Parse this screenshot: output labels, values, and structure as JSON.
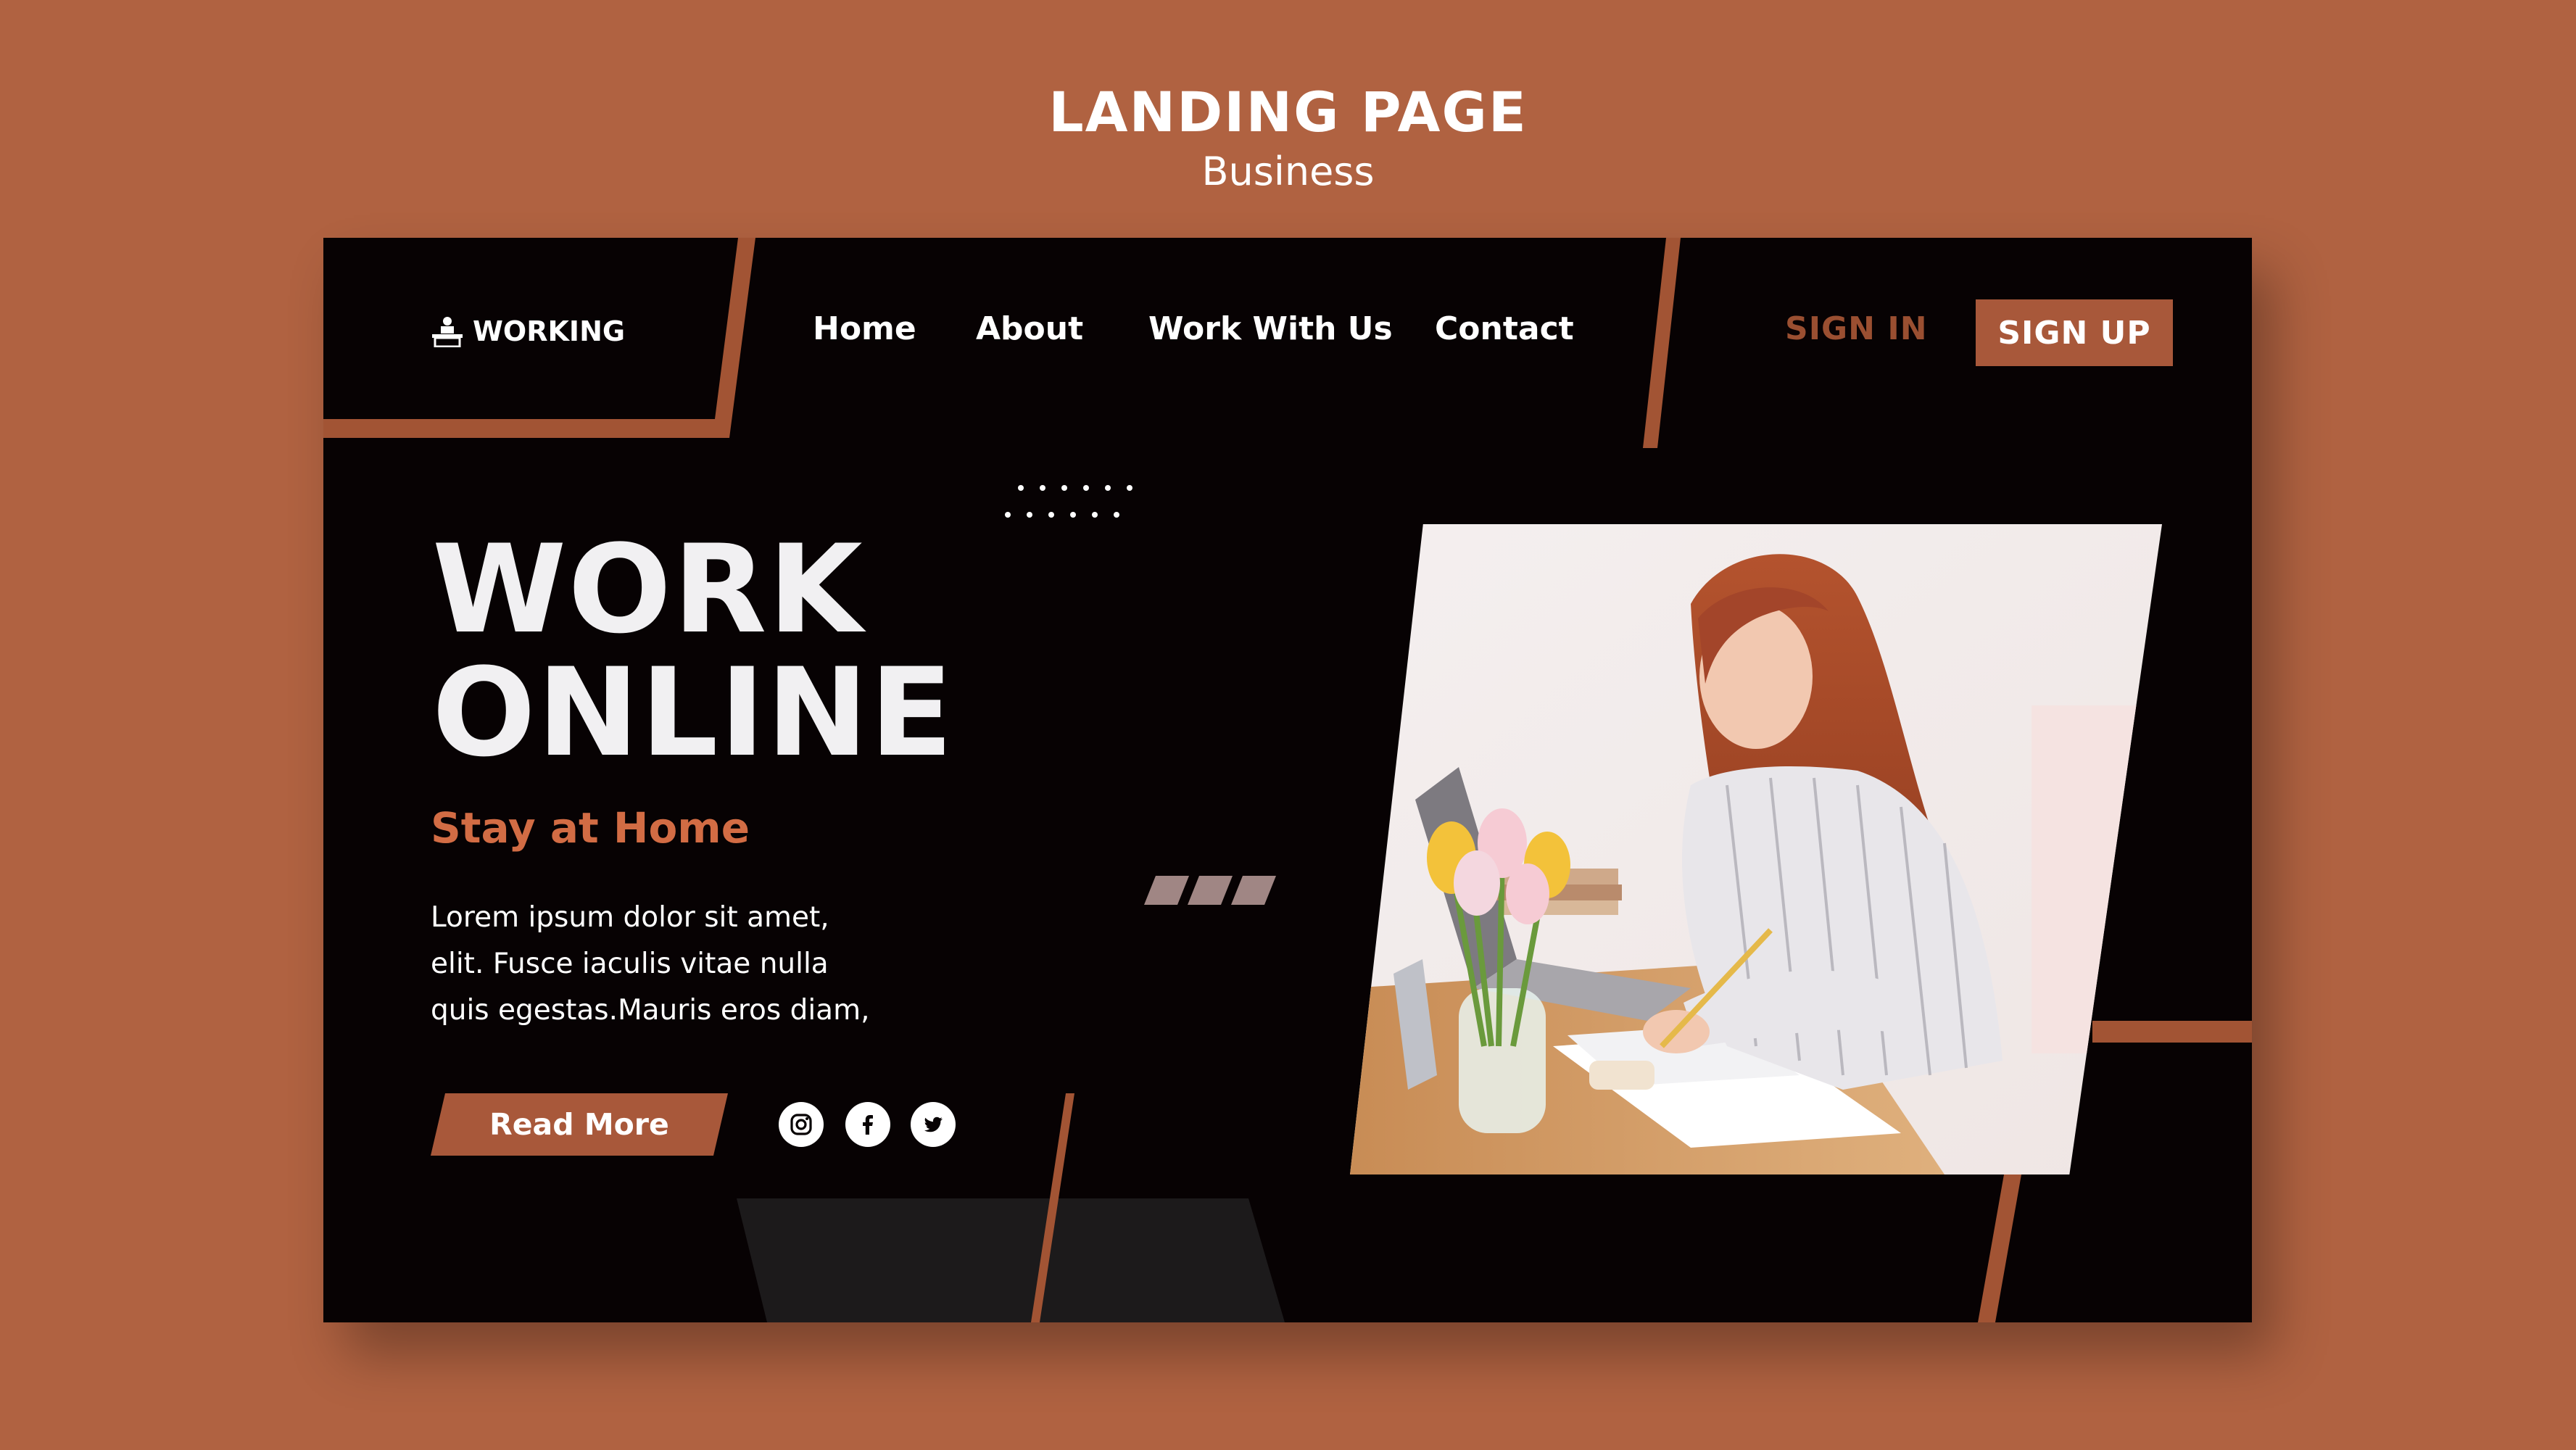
{
  "page": {
    "heading": "LANDING PAGE",
    "subheading": "Business"
  },
  "brand": {
    "logo_text": "WORKING",
    "logo_icon": "desk-worker-icon"
  },
  "nav": {
    "items": [
      {
        "label": "Home"
      },
      {
        "label": "About"
      },
      {
        "label": "Work With Us"
      },
      {
        "label": "Contact"
      }
    ]
  },
  "auth": {
    "sign_in": "SIGN IN",
    "sign_up": "SIGN UP"
  },
  "hero": {
    "title_line1": "WORK",
    "title_line2": "ONLINE",
    "subtitle": "Stay at Home",
    "body_lines": [
      "Lorem ipsum dolor sit amet,",
      "elit. Fusce iaculis vitae nulla",
      "quis egestas.Mauris eros diam,"
    ],
    "cta": "Read More"
  },
  "social": [
    "instagram-icon",
    "facebook-icon",
    "twitter-icon"
  ],
  "colors": {
    "background": "#b06241",
    "card": "#070203",
    "accent": "#a8583a",
    "accent_text": "#d26c44",
    "muted_shape": "#a08684"
  }
}
